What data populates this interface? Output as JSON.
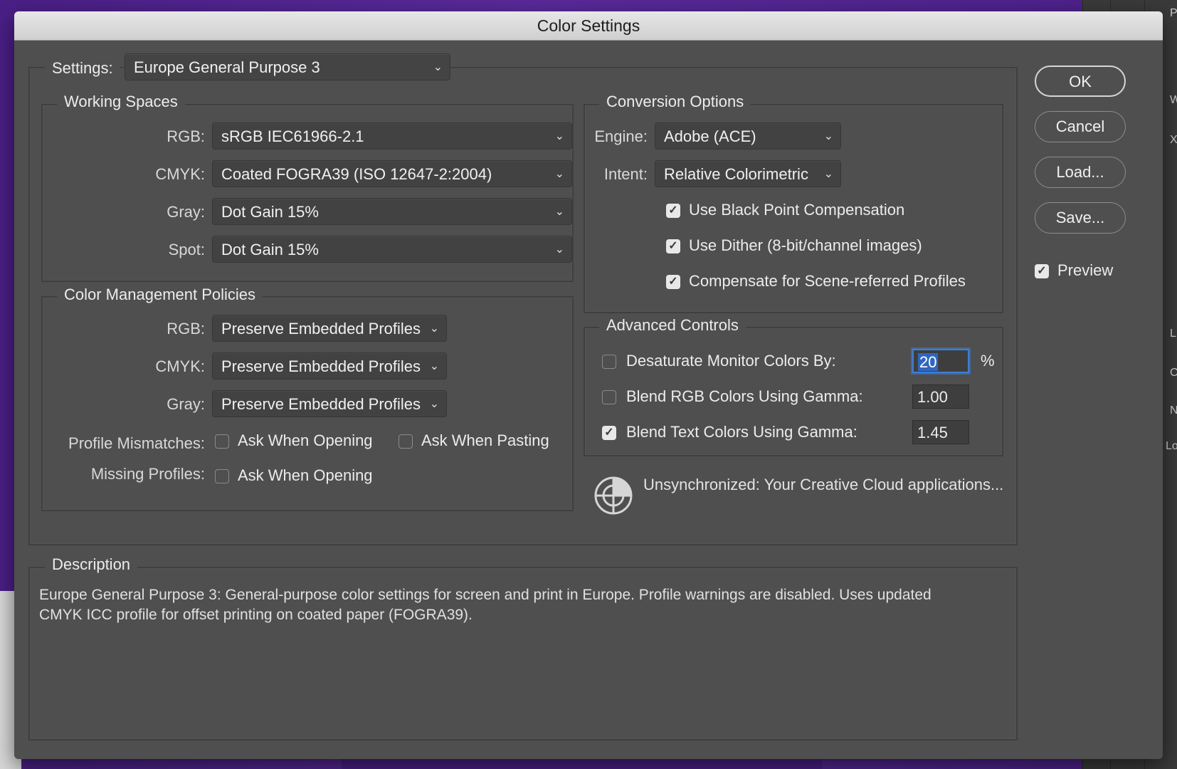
{
  "window": {
    "title": "Color Settings"
  },
  "settings": {
    "label": "Settings:",
    "value": "Europe General Purpose 3"
  },
  "working_spaces": {
    "title": "Working Spaces",
    "rgb": {
      "label": "RGB:",
      "value": "sRGB IEC61966-2.1"
    },
    "cmyk": {
      "label": "CMYK:",
      "value": "Coated FOGRA39 (ISO 12647-2:2004)"
    },
    "gray": {
      "label": "Gray:",
      "value": "Dot Gain 15%"
    },
    "spot": {
      "label": "Spot:",
      "value": "Dot Gain 15%"
    }
  },
  "policies": {
    "title": "Color Management Policies",
    "rgb": {
      "label": "RGB:",
      "value": "Preserve Embedded Profiles"
    },
    "cmyk": {
      "label": "CMYK:",
      "value": "Preserve Embedded Profiles"
    },
    "gray": {
      "label": "Gray:",
      "value": "Preserve Embedded Profiles"
    },
    "profile_mismatches": {
      "label": "Profile Mismatches:",
      "ask_opening": {
        "label": "Ask When Opening",
        "checked": false
      },
      "ask_pasting": {
        "label": "Ask When Pasting",
        "checked": false
      }
    },
    "missing_profiles": {
      "label": "Missing Profiles:",
      "ask_opening": {
        "label": "Ask When Opening",
        "checked": false
      }
    }
  },
  "conversion": {
    "title": "Conversion Options",
    "engine": {
      "label": "Engine:",
      "value": "Adobe (ACE)"
    },
    "intent": {
      "label": "Intent:",
      "value": "Relative Colorimetric"
    },
    "black_point": {
      "label": "Use Black Point Compensation",
      "checked": true
    },
    "dither": {
      "label": "Use Dither (8-bit/channel images)",
      "checked": true
    },
    "scene_referred": {
      "label": "Compensate for Scene-referred Profiles",
      "checked": true
    }
  },
  "advanced": {
    "title": "Advanced Controls",
    "desaturate": {
      "label": "Desaturate Monitor Colors By:",
      "checked": false,
      "value": "20",
      "unit": "%"
    },
    "blend_rgb": {
      "label": "Blend RGB Colors Using Gamma:",
      "checked": false,
      "value": "1.00"
    },
    "blend_text": {
      "label": "Blend Text Colors Using Gamma:",
      "checked": true,
      "value": "1.45"
    }
  },
  "sync": {
    "text": "Unsynchronized: Your Creative Cloud applications...",
    "icon": "sync-status-icon"
  },
  "description": {
    "title": "Description",
    "text": "Europe General Purpose 3:  General-purpose color settings for screen and print in Europe. Profile warnings are disabled. Uses updated CMYK ICC profile for offset printing on coated paper (FOGRA39)."
  },
  "buttons": {
    "ok": "OK",
    "cancel": "Cancel",
    "load": "Load...",
    "save": "Save..."
  },
  "preview": {
    "label": "Preview",
    "checked": true
  },
  "background": {
    "edge_letters": [
      "P",
      "W",
      "X",
      "L",
      "C",
      "N",
      "Lo"
    ]
  },
  "colors": {
    "panel": "#4f4f4f",
    "titlebar": "#dcdcdc",
    "focus": "#3f7fd6",
    "backdrop": "#4a1f86"
  }
}
